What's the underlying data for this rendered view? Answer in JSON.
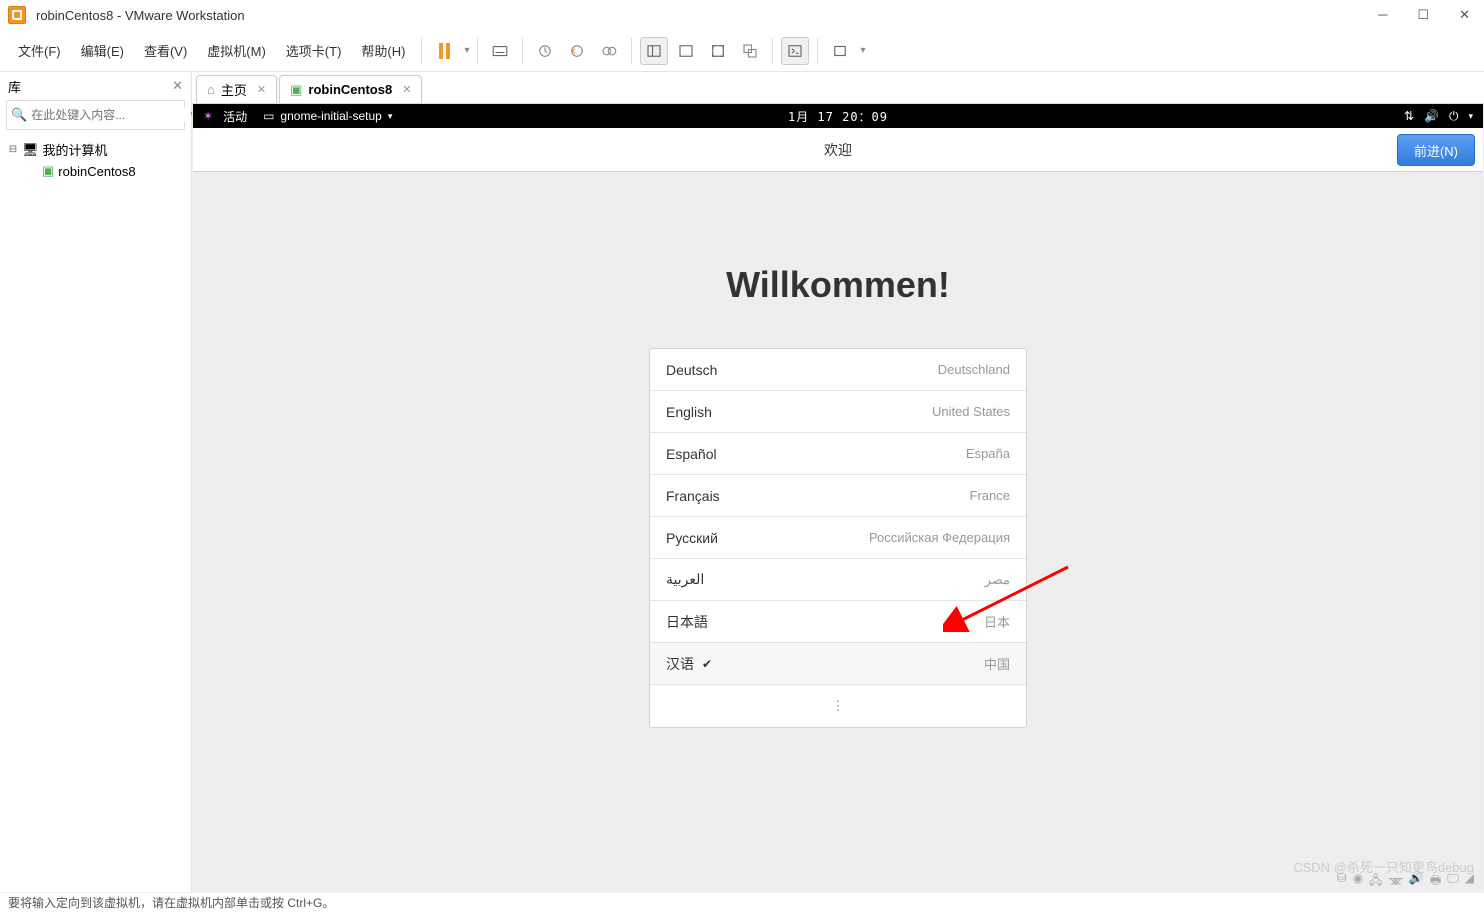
{
  "titlebar": {
    "title": "robinCentos8 - VMware Workstation"
  },
  "menubar": {
    "file": "文件(F)",
    "edit": "编辑(E)",
    "view": "查看(V)",
    "vm": "虚拟机(M)",
    "tabs": "选项卡(T)",
    "help": "帮助(H)"
  },
  "sidebar": {
    "title": "库",
    "search_placeholder": "在此处键入内容...",
    "root": "我的计算机",
    "child": "robinCentos8"
  },
  "tabs": {
    "home": "主页",
    "vm": "robinCentos8"
  },
  "gnome": {
    "activities": "活动",
    "app": "gnome-initial-setup",
    "clock": "1月 17 20：09",
    "header_title": "欢迎",
    "next_button": "前进(N)"
  },
  "welcome": {
    "title": "Willkommen!",
    "languages": [
      {
        "name": "Deutsch",
        "country": "Deutschland",
        "selected": false
      },
      {
        "name": "English",
        "country": "United States",
        "selected": false
      },
      {
        "name": "Español",
        "country": "España",
        "selected": false
      },
      {
        "name": "Français",
        "country": "France",
        "selected": false
      },
      {
        "name": "Русский",
        "country": "Российская Федерация",
        "selected": false
      },
      {
        "name": "العربية",
        "country": "مصر",
        "selected": false
      },
      {
        "name": "日本語",
        "country": "日本",
        "selected": false
      },
      {
        "name": "汉语",
        "country": "中国",
        "selected": true
      }
    ]
  },
  "statusbar": {
    "hint": "要将输入定向到该虚拟机，请在虚拟机内部单击或按 Ctrl+G。"
  },
  "watermark": "CSDN @杀死一只知更鸟debug"
}
